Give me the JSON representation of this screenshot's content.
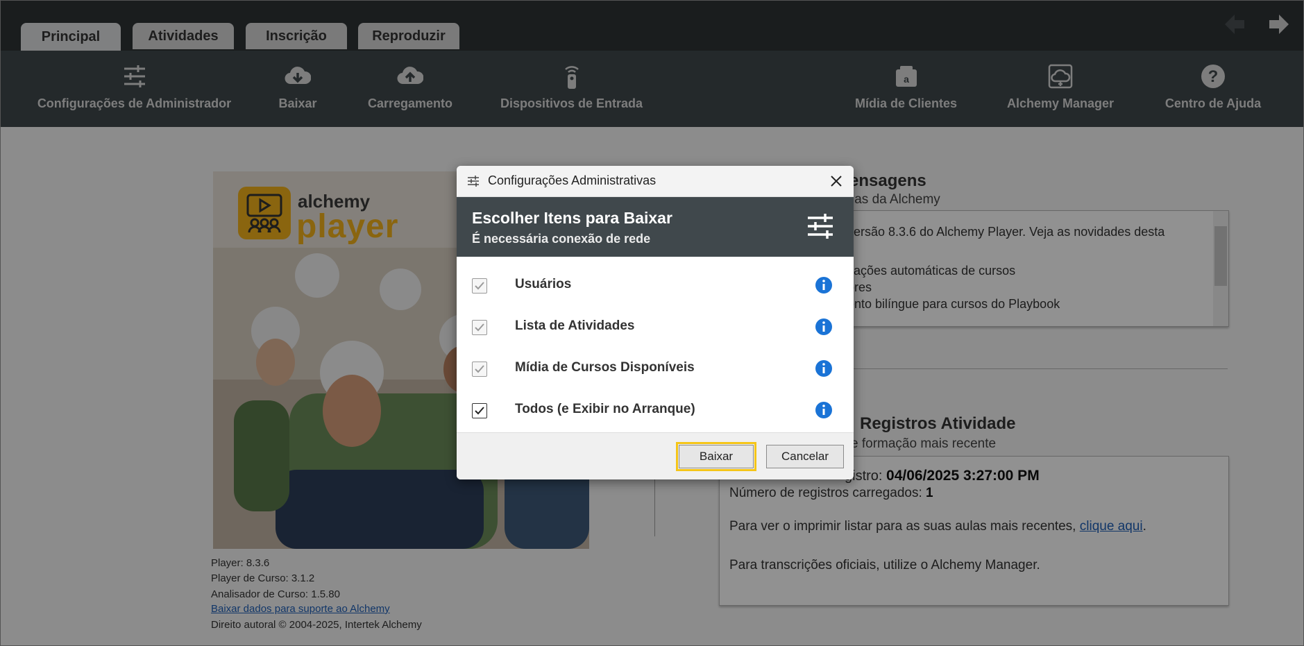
{
  "tabs": [
    {
      "label": "Principal",
      "active": true
    },
    {
      "label": "Atividades",
      "active": false
    },
    {
      "label": "Inscrição",
      "active": false
    },
    {
      "label": "Reproduzir",
      "active": false
    }
  ],
  "nav": {
    "back_icon": "arrow-left-icon",
    "forward_icon": "arrow-right-icon"
  },
  "toolbar": {
    "admin_settings": "Configurações de Administrador",
    "download": "Baixar",
    "upload": "Carregamento",
    "input_devices": "Dispositivos de Entrada",
    "client_media": "Mídia de Clientes",
    "alchemy_manager": "Alchemy Manager",
    "help_center": "Centro de Ajuda"
  },
  "logo": {
    "line1": "alchemy",
    "line2": "player"
  },
  "version_info": {
    "player": "Player: 8.3.6",
    "course_player": "Player de Curso: 3.1.2",
    "course_analyzer": "Analisador de Curso: 1.5.80",
    "support_link": "Baixar dados para suporte ao Alchemy",
    "copyright": "Direito autoral © 2004-2025, Intertek Alchemy"
  },
  "messages": {
    "title": "ensagens",
    "subtitle": "ias da Alchemy",
    "lines": [
      "versão 8.3.6 do Alchemy Player. Veja as novidades desta",
      "zações automáticas de cursos",
      "ores",
      "ento bilíngue para cursos do Playbook"
    ]
  },
  "records": {
    "title": "Registros Atividade",
    "subtitle": "e formação mais recente",
    "last_label": "gistro:",
    "last_value": "04/06/2025 3:27:00 PM",
    "count_label": "Número de registros carregados:",
    "count_value": "1",
    "view_text": "Para ver o imprimir listar para as suas aulas mais recentes,",
    "view_link": "clique aqui",
    "view_end": ".",
    "official_text": "Para transcrições oficiais, utilize o Alchemy Manager."
  },
  "dialog": {
    "title": "Configurações Administrativas",
    "heading": "Escolher Itens para Baixar",
    "subheading": "É necessária conexão de rede",
    "options": [
      {
        "label": "Usuários",
        "checked": true,
        "disabled": true
      },
      {
        "label": "Lista de Atividades",
        "checked": true,
        "disabled": true
      },
      {
        "label": "Mídia de Cursos Disponíveis",
        "checked": true,
        "disabled": true
      },
      {
        "label": "Todos (e Exibir no Arranque)",
        "checked": true,
        "disabled": false
      }
    ],
    "download_button": "Baixar",
    "cancel_button": "Cancelar"
  },
  "colors": {
    "toolbar_bg": "#40484c",
    "tabbar_bg": "#2f3336",
    "accent_yellow": "#f5c518",
    "info_blue": "#1a73d6",
    "link_blue": "#1f5fb8"
  }
}
